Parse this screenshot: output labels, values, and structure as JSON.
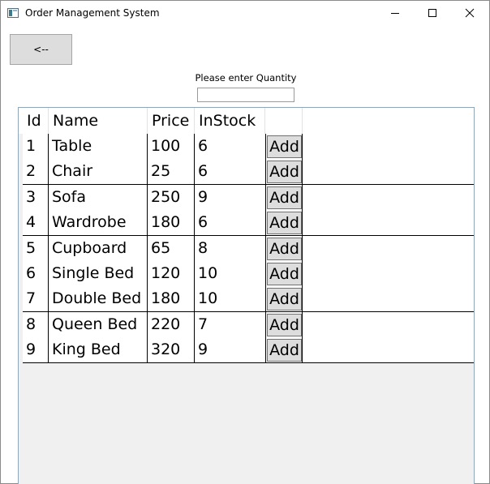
{
  "window": {
    "title": "Order Management System"
  },
  "toolbar": {
    "back_label": "<--"
  },
  "quantity": {
    "label": "Please enter Quantity",
    "value": ""
  },
  "grid": {
    "columns": [
      "Id",
      "Name",
      "Price",
      "InStock"
    ],
    "rows": [
      {
        "id": "1",
        "name": "Table",
        "price": "100",
        "instock": "6",
        "action": "Add"
      },
      {
        "id": "2",
        "name": "Chair",
        "price": "25",
        "instock": "6",
        "action": "Add"
      },
      {
        "id": "3",
        "name": "Sofa",
        "price": "250",
        "instock": "9",
        "action": "Add"
      },
      {
        "id": "4",
        "name": "Wardrobe",
        "price": "180",
        "instock": "6",
        "action": "Add"
      },
      {
        "id": "5",
        "name": "Cupboard",
        "price": "65",
        "instock": "8",
        "action": "Add"
      },
      {
        "id": "6",
        "name": "Single Bed",
        "price": "120",
        "instock": "10",
        "action": "Add"
      },
      {
        "id": "7",
        "name": "Double Bed",
        "price": "180",
        "instock": "10",
        "action": "Add"
      },
      {
        "id": "8",
        "name": "Queen Bed",
        "price": "220",
        "instock": "7",
        "action": "Add"
      },
      {
        "id": "9",
        "name": "King Bed",
        "price": "320",
        "instock": "9",
        "action": "Add"
      }
    ]
  },
  "icons": {
    "app": "app-window-icon",
    "minimize": "minimize-icon",
    "maximize": "maximize-icon",
    "close": "close-icon"
  }
}
